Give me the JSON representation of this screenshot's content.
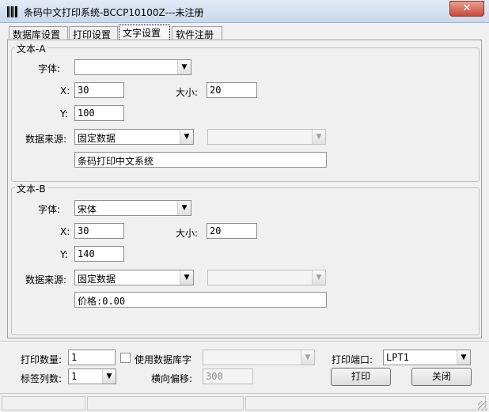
{
  "window": {
    "title": "条码中文打印系统-BCCP10100Z---未注册",
    "close_label": "✕"
  },
  "tabs": [
    {
      "label": "数据库设置"
    },
    {
      "label": "打印设置"
    },
    {
      "label": "文字设置"
    },
    {
      "label": "软件注册"
    }
  ],
  "text_a": {
    "group_title": "文本-A",
    "font_label": "字体:",
    "font_value": "",
    "x_label": "X:",
    "x_value": "30",
    "size_label": "大小:",
    "size_value": "20",
    "y_label": "Y:",
    "y_value": "100",
    "source_label": "数据来源:",
    "source_value": "固定数据",
    "source2_value": "",
    "content_value": "条码打印中文系统"
  },
  "text_b": {
    "group_title": "文本-B",
    "font_label": "字体:",
    "font_value": "宋体",
    "x_label": "X:",
    "x_value": "30",
    "size_label": "大小:",
    "size_value": "20",
    "y_label": "Y:",
    "y_value": "140",
    "source_label": "数据来源:",
    "source_value": "固定数据",
    "source2_value": "",
    "content_value": "价格:0.00"
  },
  "bottom": {
    "print_qty_label": "打印数量:",
    "print_qty_value": "1",
    "use_db_label": "使用数据库字",
    "db_field_value": "",
    "port_label": "打印端口:",
    "port_value": "LPT1",
    "columns_label": "标签列数:",
    "columns_value": "1",
    "offset_label": "横向偏移:",
    "offset_value": "300",
    "print_button": "打印",
    "close_button": "关闭"
  }
}
